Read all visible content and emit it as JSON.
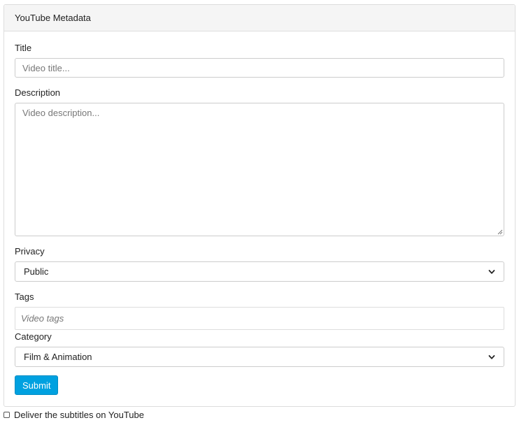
{
  "panel": {
    "title": "YouTube Metadata"
  },
  "form": {
    "title": {
      "label": "Title",
      "placeholder": "Video title..."
    },
    "description": {
      "label": "Description",
      "placeholder": "Video description..."
    },
    "privacy": {
      "label": "Privacy",
      "selected": "Public"
    },
    "tags": {
      "label": "Tags",
      "placeholder": "Video tags"
    },
    "category": {
      "label": "Category",
      "selected": "Film & Animation"
    },
    "submit_label": "Submit"
  },
  "deliver": {
    "label": "Deliver the subtitles on YouTube",
    "checked": false
  },
  "colors": {
    "accent": "#00a1e0",
    "panel_heading_bg": "#f5f5f5",
    "border": "#cccccc"
  },
  "icons": {
    "select_arrow": "chevron-down-icon",
    "textarea_resize": "resize-grip-icon"
  }
}
